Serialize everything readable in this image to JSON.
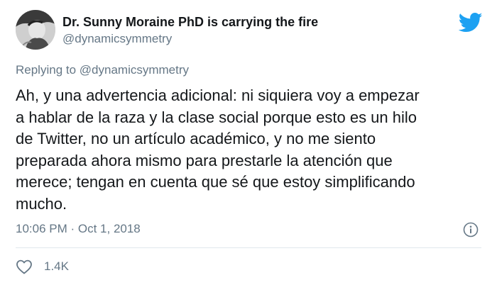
{
  "author": {
    "display_name": "Dr. Sunny Moraine PhD is carrying the fire",
    "handle": "@dynamicsymmetry"
  },
  "reply": {
    "prefix": "Replying to",
    "handle": "@dynamicsymmetry"
  },
  "tweet": {
    "lines": [
      "Ah, y una advertencia adicional: ni siquiera voy a empezar",
      "a hablar de la raza y la clase social porque esto es un hilo",
      "de Twitter, no un artículo académico, y no me siento",
      "preparada ahora mismo para prestarle la atención que",
      "merece; tengan en cuenta que sé que estoy simplificando",
      "mucho."
    ]
  },
  "meta": {
    "timestamp": "10:06 PM · Oct 1, 2018"
  },
  "actions": {
    "like_count": "1.4K"
  },
  "icons": {
    "brand": "twitter-bird-icon",
    "info": "info-icon",
    "like": "heart-icon"
  },
  "colors": {
    "brand_blue": "#1da1f2",
    "secondary_text": "#657786",
    "primary_text": "#14171a",
    "divider": "#e1e8ed"
  }
}
